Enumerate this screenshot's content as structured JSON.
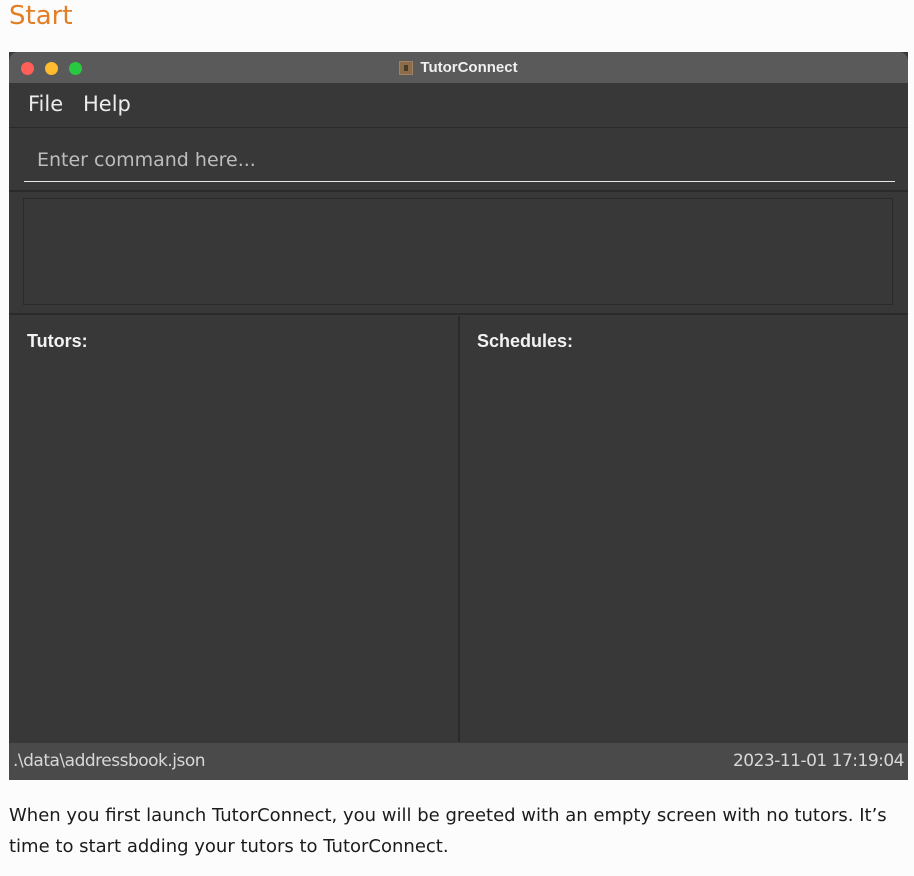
{
  "section_heading": "Start",
  "window": {
    "title": "TutorConnect",
    "menu": [
      "File",
      "Help"
    ],
    "command_placeholder": "Enter command here...",
    "command_value": "",
    "result_text": "",
    "panels": {
      "tutors_title": "Tutors:",
      "schedules_title": "Schedules:"
    },
    "status": {
      "file_path": ".\\data\\addressbook.json",
      "timestamp": "2023-11-01 17:19:04"
    }
  },
  "description": "When you first launch TutorConnect, you will be greeted with an empty screen with no tutors. It’s time to start adding your tutors to TutorConnect.",
  "colors": {
    "heading": "#e37e24",
    "window_bg": "#383838",
    "titlebar": "#5a5a5a",
    "statusbar": "#4a4a4a"
  }
}
